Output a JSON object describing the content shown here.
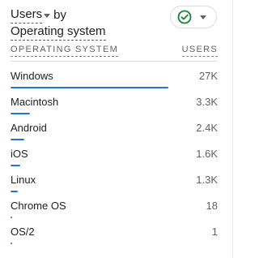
{
  "card": {
    "title_metric": "Users",
    "title_connector": "by",
    "title_dimension": "Operating system",
    "compare_status": "check-circle-icon",
    "accent_color": "#1a73e8",
    "check_color": "#188038"
  },
  "table": {
    "col_dimension": "OPERATING SYSTEM",
    "col_metric": "USERS",
    "rows": [
      {
        "label": "Windows",
        "value": "27K",
        "share": 1.0
      },
      {
        "label": "Macintosh",
        "value": "3.3K",
        "share": 0.122
      },
      {
        "label": "Android",
        "value": "2.4K",
        "share": 0.089
      },
      {
        "label": "iOS",
        "value": "1.6K",
        "share": 0.059
      },
      {
        "label": "Linux",
        "value": "1.3K",
        "share": 0.048
      },
      {
        "label": "Chrome OS",
        "value": "18",
        "share": 0.0007
      },
      {
        "label": "OS/2",
        "value": "1",
        "share": 4e-05
      }
    ]
  }
}
